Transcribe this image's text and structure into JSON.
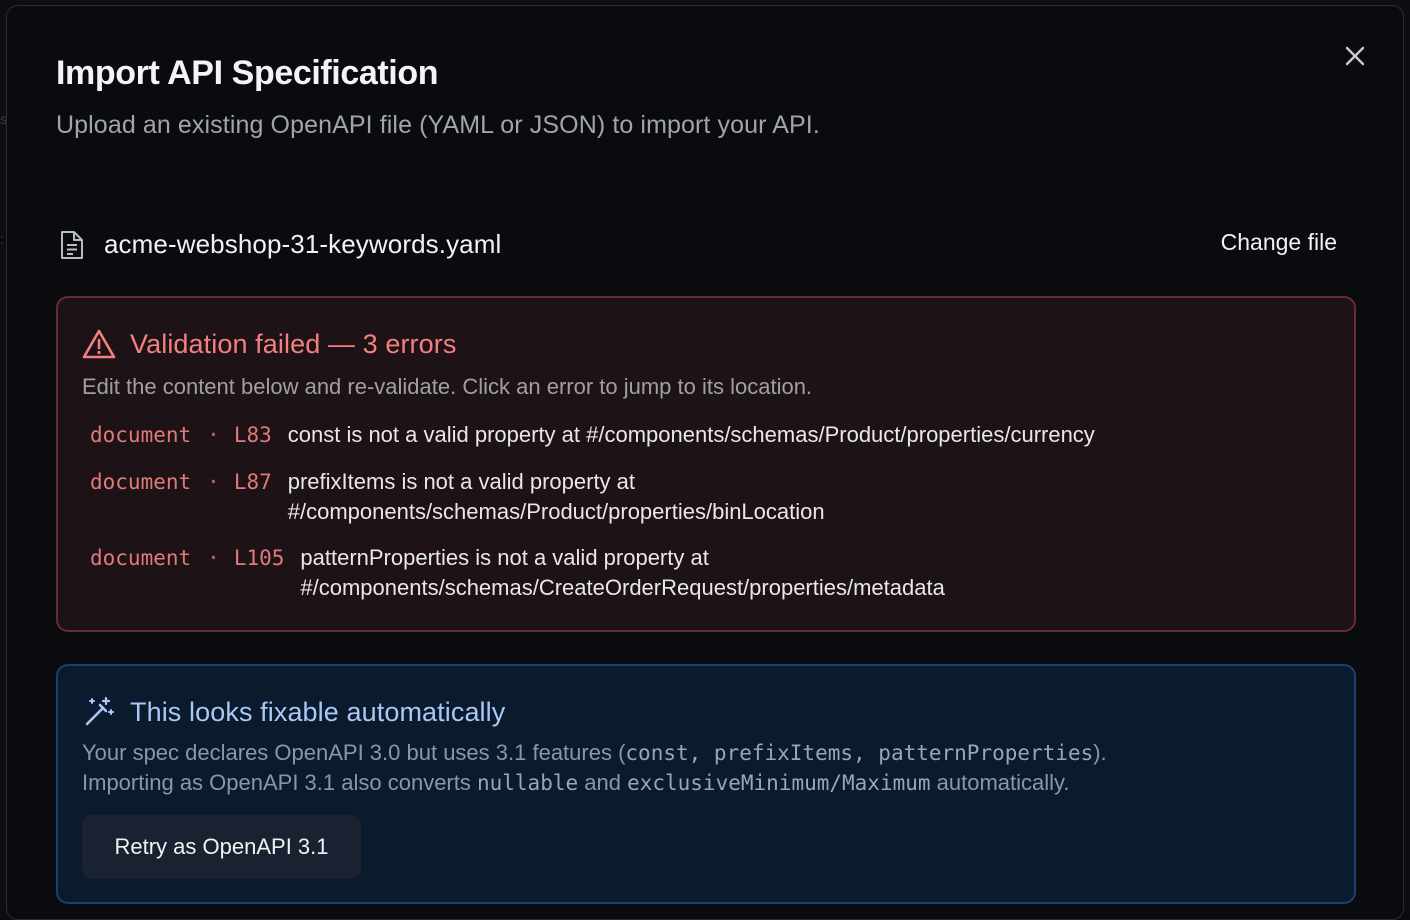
{
  "dialog": {
    "title": "Import API Specification",
    "subtitle": "Upload an existing OpenAPI file (YAML or JSON) to import your API.",
    "close_icon": "close-icon"
  },
  "file": {
    "icon": "file-text-icon",
    "name": "acme-webshop-31-keywords.yaml",
    "change_label": "Change file"
  },
  "validation": {
    "icon": "alert-triangle-icon",
    "title": "Validation failed — 3 errors",
    "description": "Edit the content below and re-validate. Click an error to jump to its location.",
    "errors": [
      {
        "source": "document",
        "separator": "·",
        "line": "L83",
        "message_lines": [
          "const is not a valid property at #/components/schemas/Product/properties/currency"
        ]
      },
      {
        "source": "document",
        "separator": "·",
        "line": "L87",
        "message_lines": [
          "prefixItems is not a valid property at",
          "#/components/schemas/Product/properties/binLocation"
        ]
      },
      {
        "source": "document",
        "separator": "·",
        "line": "L105",
        "message_lines": [
          "patternProperties is not a valid property at",
          "#/components/schemas/CreateOrderRequest/properties/metadata"
        ]
      }
    ]
  },
  "fix": {
    "icon": "magic-wand-icon",
    "title": "This looks fixable automatically",
    "line1": {
      "pre": "Your spec declares OpenAPI 3.0 but uses 3.1 features (",
      "c1": "const",
      "sep1": ", ",
      "c2": "prefixItems",
      "sep2": ", ",
      "c3": "patternProperties",
      "post": ")."
    },
    "line2": {
      "pre": "Importing as OpenAPI 3.1 also converts ",
      "c1": "nullable",
      "mid": " and ",
      "c2": "exclusiveMinimum/Maximum",
      "post": " automatically."
    },
    "retry_label": "Retry as OpenAPI 3.1"
  },
  "colors": {
    "error_accent": "#f37f7f",
    "info_accent": "#a8c9f5",
    "dialog_bg": "#0a0b0e"
  }
}
